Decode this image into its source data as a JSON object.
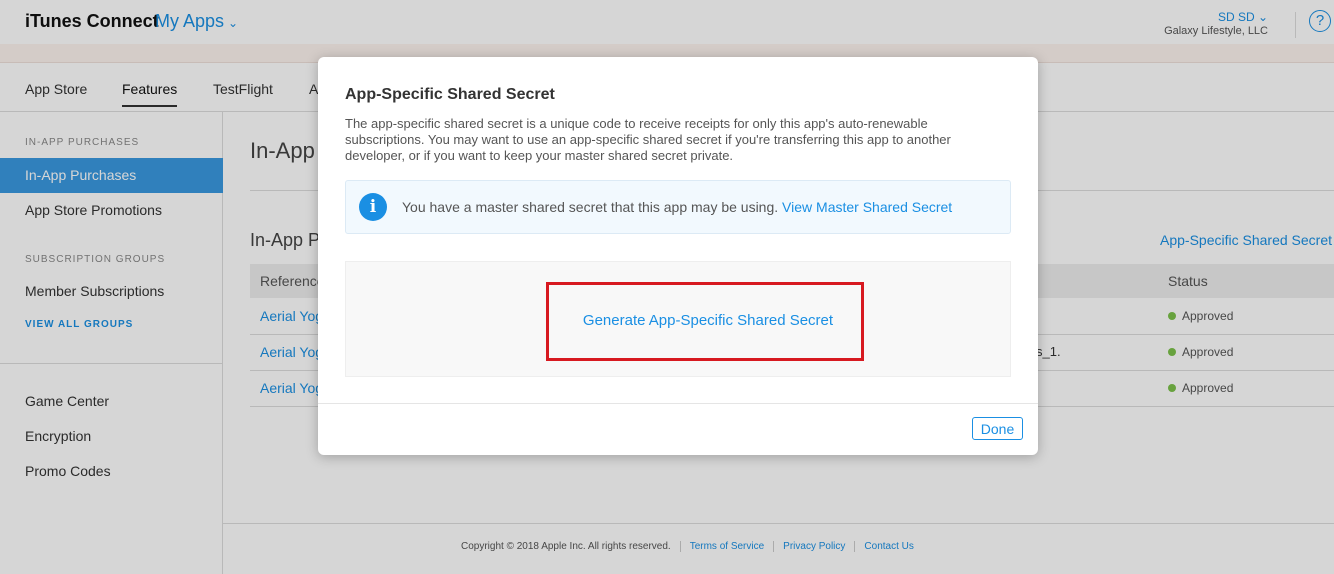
{
  "header": {
    "brand": "iTunes Connect",
    "nav_title": "My Apps",
    "nav_chevron": "⌄",
    "user_name": "SD SD ⌄",
    "organization": "Galaxy Lifestyle, LLC",
    "help_icon": "?"
  },
  "tabs": [
    {
      "label": "App Store"
    },
    {
      "label": "Features"
    },
    {
      "label": "TestFlight"
    },
    {
      "label": "A"
    }
  ],
  "sidebar": {
    "section1": "IN-APP PURCHASES",
    "items1": [
      "In-App Purchases",
      "App Store Promotions"
    ],
    "section2": "SUBSCRIPTION GROUPS",
    "items2": [
      "Member Subscriptions"
    ],
    "view_all": "VIEW ALL GROUPS",
    "items3": [
      "Game Center",
      "Encryption",
      "Promo Codes"
    ]
  },
  "main": {
    "page_title": "In-App",
    "section_title": "In-App P",
    "section_link": "App-Specific Shared Secret",
    "table": {
      "headers": [
        "Reference",
        "Status"
      ],
      "rows": [
        {
          "name": "Aerial Yog",
          "mid": "",
          "status": "Approved"
        },
        {
          "name": "Aerial Yog",
          "mid": "s_1.",
          "status": "Approved"
        },
        {
          "name": "Aerial Yog",
          "mid": "",
          "status": "Approved"
        }
      ]
    }
  },
  "footer": {
    "copyright": "Copyright © 2018 Apple Inc. All rights reserved.",
    "links": [
      "Terms of Service",
      "Privacy Policy",
      "Contact Us"
    ]
  },
  "modal": {
    "title": "App-Specific Shared Secret",
    "description": "The app-specific shared secret is a unique code to receive receipts for only this app's auto-renewable subscriptions. You may want to use an app-specific shared secret if you're transferring this app to another developer, or if you want to keep your master shared secret private.",
    "info_icon": "i",
    "info_text": "You have a master shared secret that this app may be using.",
    "info_link": "View Master Shared Secret",
    "generate_link": "Generate App-Specific Shared Secret",
    "done_label": "Done"
  },
  "colors": {
    "accent": "#1a8fe3",
    "sidebar_active": "#3a99e0",
    "highlight": "#d71920",
    "status_approved": "#7cc24b"
  }
}
